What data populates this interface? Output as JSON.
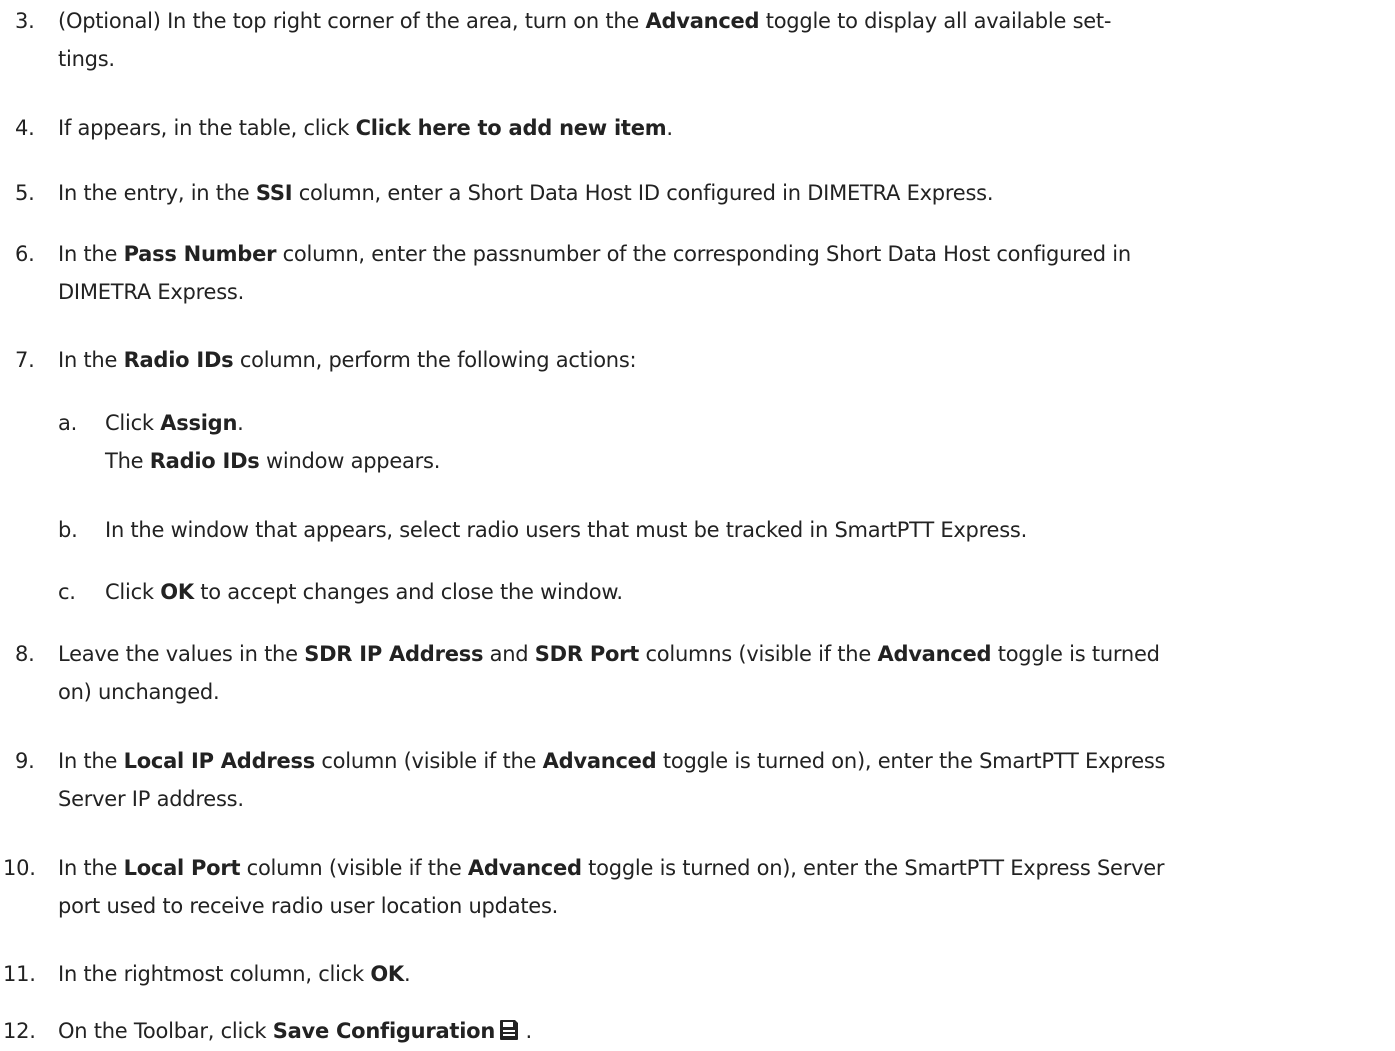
{
  "steps": [
    {
      "number": "3.",
      "parts": [
        "(Optional) In the top right corner of the area, turn on the ",
        "Advanced",
        " toggle to display all available set-",
        "tings."
      ]
    },
    {
      "number": "4.",
      "parts": [
        "If appears, in the table, click ",
        "Click here to add new item",
        "."
      ]
    },
    {
      "number": "5.",
      "parts": [
        "In the entry, in the ",
        "SSI",
        " column, enter a Short Data Host ID configured in DIMETRA Express."
      ]
    },
    {
      "number": "6.",
      "parts": [
        "In the ",
        "Pass Number",
        " column, enter the passnumber of the corresponding Short Data Host configured in",
        "DIMETRA Express."
      ]
    },
    {
      "number": "7.",
      "parts": [
        "In the ",
        "Radio IDs",
        " column, perform the following actions:"
      ]
    },
    {
      "number": "8.",
      "parts": [
        "Leave the values in the ",
        "SDR IP Address",
        " and ",
        "SDR Port",
        " columns (visible if the ",
        "Advanced",
        " toggle is turned",
        "on) unchanged."
      ]
    },
    {
      "number": "9.",
      "parts": [
        "In the ",
        "Local IP Address",
        " column (visible if the ",
        "Advanced",
        " toggle is turned on), enter the SmartPTT Express",
        "Server IP address."
      ]
    },
    {
      "number": "10.",
      "parts": [
        "In the ",
        "Local Port",
        " column (visible if the ",
        "Advanced",
        " toggle is turned on), enter the SmartPTT Express Server",
        "port used to receive radio user location updates."
      ]
    },
    {
      "number": "11.",
      "parts": [
        "In the rightmost column, click ",
        "OK",
        "."
      ]
    },
    {
      "number": "12.",
      "parts": [
        "On the Toolbar, click ",
        "Save Configuration",
        " ."
      ]
    }
  ],
  "substeps": [
    {
      "letter": "a.",
      "parts": [
        "Click ",
        "Assign",
        ".",
        "The ",
        "Radio IDs",
        " window appears."
      ]
    },
    {
      "letter": "b.",
      "parts": [
        "In the window that appears, select radio users that must be tracked in SmartPTT Express."
      ]
    },
    {
      "letter": "c.",
      "parts": [
        "Click ",
        "OK",
        " to accept changes and close the window."
      ]
    }
  ],
  "icons": {
    "save": "floppy-disk-icon",
    "color": "#222222"
  }
}
